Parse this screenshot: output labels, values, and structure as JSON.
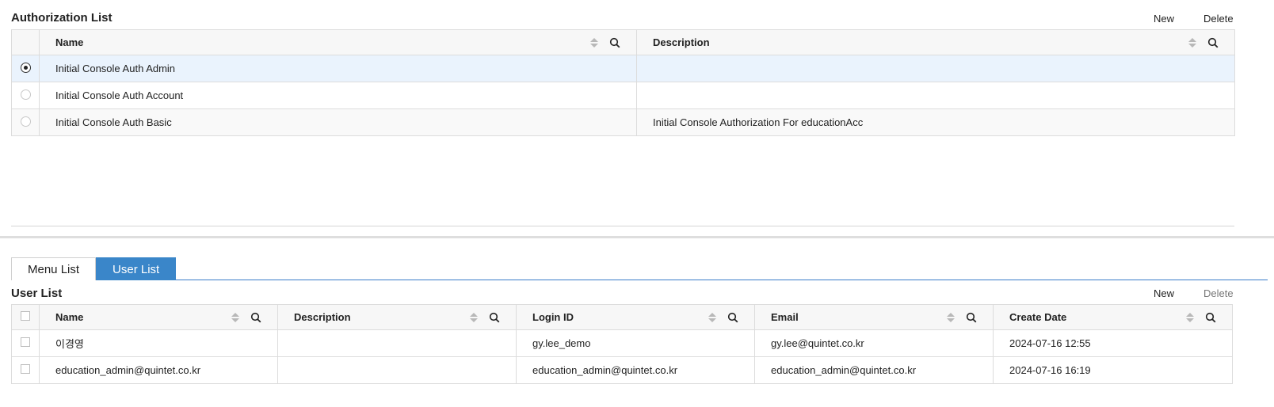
{
  "auth": {
    "title": "Authorization List",
    "new_label": "New",
    "delete_label": "Delete",
    "columns": {
      "name": "Name",
      "description": "Description"
    },
    "rows": [
      {
        "name": "Initial Console Auth Admin",
        "description": "",
        "selected": true
      },
      {
        "name": "Initial Console Auth Account",
        "description": "",
        "selected": false
      },
      {
        "name": "Initial Console Auth Basic",
        "description": "Initial Console Authorization For educationAcc",
        "selected": false
      }
    ]
  },
  "tabs": [
    {
      "label": "Menu List",
      "active": false
    },
    {
      "label": "User List",
      "active": true
    }
  ],
  "users": {
    "title": "User List",
    "new_label": "New",
    "delete_label": "Delete",
    "columns": {
      "name": "Name",
      "description": "Description",
      "login_id": "Login ID",
      "email": "Email",
      "create_date": "Create Date"
    },
    "rows": [
      {
        "name": "이경영",
        "description": "",
        "login_id": "gy.lee_demo",
        "email": "gy.lee@quintet.co.kr",
        "create_date": "2024-07-16 12:55"
      },
      {
        "name": "education_admin@quintet.co.kr",
        "description": "",
        "login_id": "education_admin@quintet.co.kr",
        "email": "education_admin@quintet.co.kr",
        "create_date": "2024-07-16 16:19"
      }
    ]
  },
  "icons": {
    "sort": "sort-icon",
    "search": "search-icon",
    "radio": "radio-icon",
    "checkbox": "checkbox-icon"
  },
  "colors": {
    "accent": "#3a86c9",
    "selected_row": "#eaf3fd",
    "header_bg": "#f7f7f7"
  }
}
